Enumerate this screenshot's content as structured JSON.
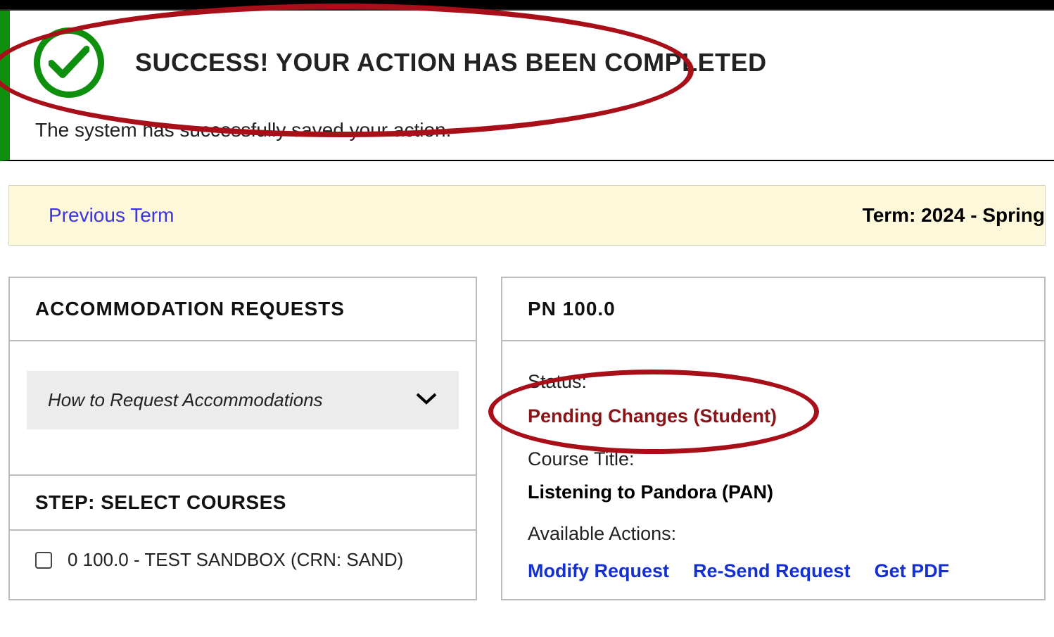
{
  "banner": {
    "title": "SUCCESS! YOUR ACTION HAS BEEN COMPLETED",
    "subtext": "The system has successfully saved your action."
  },
  "termbar": {
    "prev_link": "Previous Term",
    "term_label": "Term: 2024 - Spring"
  },
  "left_panel": {
    "header": "ACCOMMODATION REQUESTS",
    "accordion_title": "How to Request Accommodations",
    "step_header": "STEP: SELECT COURSES",
    "course_option": "0 100.0 - TEST SANDBOX (CRN: SAND)"
  },
  "right_panel": {
    "header": "PN 100.0",
    "status_label": "Status:",
    "status_value": "Pending Changes (Student)",
    "course_title_label": "Course Title:",
    "course_title_value": "Listening to Pandora (PAN)",
    "actions_label": "Available Actions:",
    "actions": {
      "modify": "Modify Request",
      "resend": "Re-Send Request",
      "pdf": "Get PDF"
    }
  }
}
